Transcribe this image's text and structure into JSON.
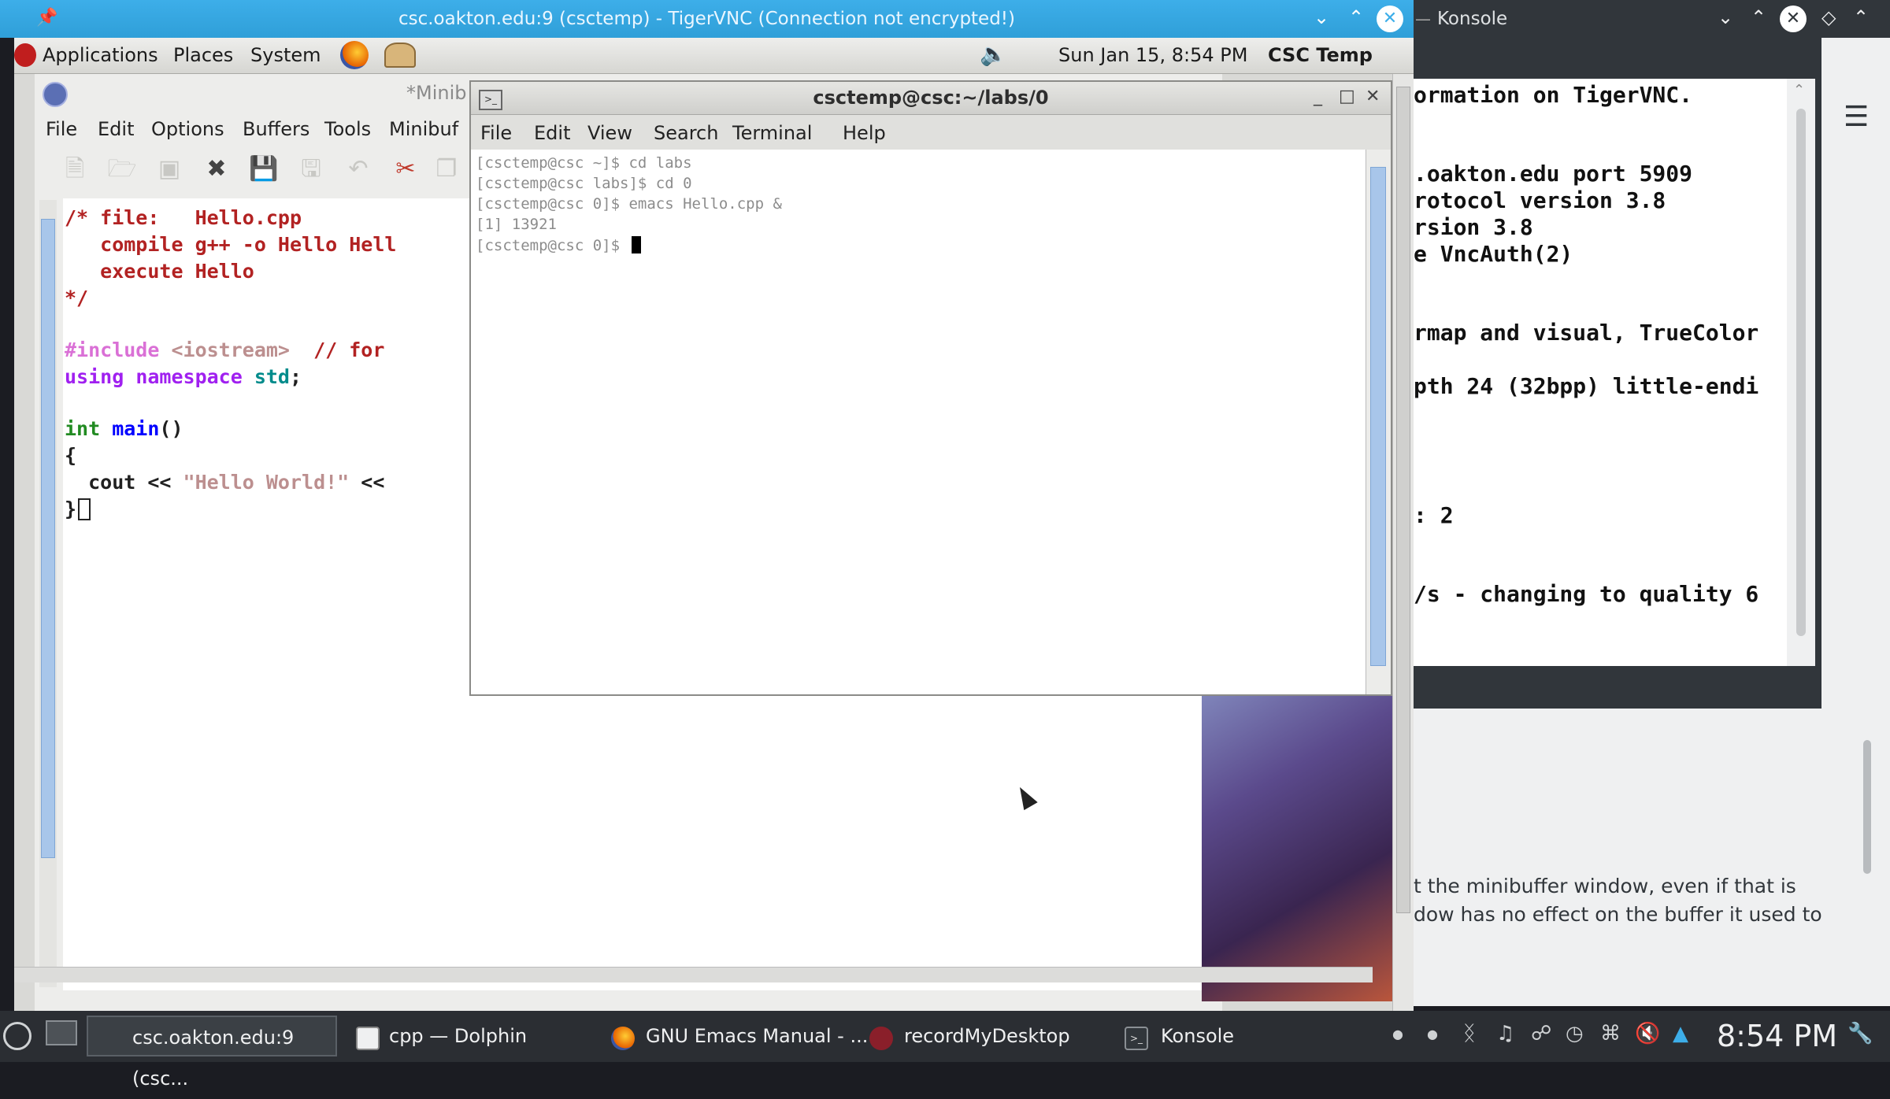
{
  "vnc_window": {
    "title": "csc.oakton.edu:9 (csctemp) - TigerVNC (Connection not encrypted!)"
  },
  "gnome_panel": {
    "menus": [
      "Applications",
      "Places",
      "System"
    ],
    "datetime": "Sun Jan 15,  8:54 PM",
    "user": "CSC Temp"
  },
  "emacs": {
    "title": "*Minib",
    "menubar": [
      "File",
      "Edit",
      "Options",
      "Buffers",
      "Tools",
      "Minibuf"
    ],
    "code": {
      "l1": "/* file:   Hello.cpp",
      "l2a": "   compile g++ -o Hello Hell",
      "l3": "   execute Hello",
      "l4": "*/",
      "l6_pp": "#include",
      "l6_hdr": " <iostream>",
      "l6_cmt": "  // for",
      "l7_kw1": "using",
      "l7_kw2": " namespace",
      "l7_std": " std",
      "l7_end": ";",
      "l9_type": "int",
      "l9_fn": " main",
      "l9_rest": "()",
      "l10": "{",
      "l11_a": "  cout << ",
      "l11_str": "\"Hello World!\"",
      "l11_b": " <<",
      "l12": "}"
    }
  },
  "terminal": {
    "title": "csctemp@csc:~/labs/0",
    "menubar": [
      "File",
      "Edit",
      "View",
      "Search",
      "Terminal",
      "Help"
    ],
    "lines": [
      "[csctemp@csc ~]$ cd labs",
      "[csctemp@csc labs]$ cd 0",
      "[csctemp@csc 0]$ emacs Hello.cpp &",
      "[1] 13921",
      "[csctemp@csc 0]$ "
    ]
  },
  "konsole": {
    "title": "Konsole",
    "lines": [
      "ormation on TigerVNC.",
      "",
      ".oakton.edu port 5909",
      "rotocol version 3.8",
      "rsion 3.8",
      "e VncAuth(2)",
      "",
      "",
      "rmap and visual, TrueColor",
      "",
      "pth 24 (32bpp) little-endi",
      "",
      "",
      "",
      "",
      ": 2",
      "",
      "",
      "/s - changing to quality 6"
    ]
  },
  "help_browser": {
    "lines": [
      "t the minibuffer window, even if that is",
      "dow has no effect on the buffer it used to"
    ]
  },
  "taskbar": {
    "tasks": [
      {
        "label": "csc.oakton.edu:9 (csc...",
        "active": true
      },
      {
        "label": "cpp — Dolphin",
        "active": false
      },
      {
        "label": "GNU Emacs Manual - ...",
        "active": false
      },
      {
        "label": "recordMyDesktop",
        "active": false
      },
      {
        "label": "Konsole",
        "active": false
      }
    ],
    "clock": "8:54 PM"
  },
  "colors": {
    "kde_blue": "#3daee9",
    "breeze_dark": "#31363b",
    "emacs_comment": "#b22222",
    "emacs_keyword": "#a020f0"
  }
}
